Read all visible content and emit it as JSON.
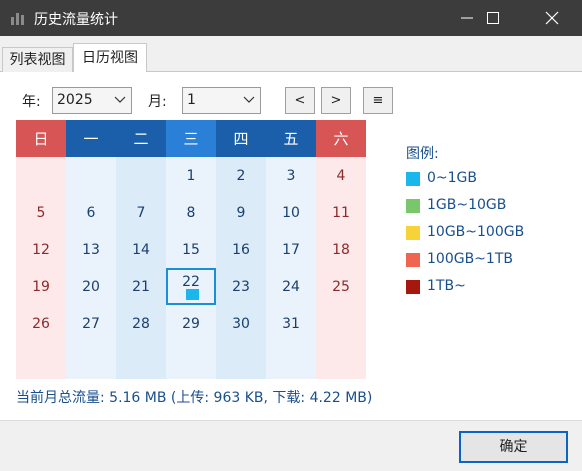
{
  "window": {
    "title": "历史流量统计"
  },
  "tabs": [
    {
      "label": "列表视图"
    },
    {
      "label": "日历视图"
    }
  ],
  "controls": {
    "year_label": "年:",
    "year_value": "2025",
    "month_label": "月:",
    "month_value": "1",
    "prev_label": "<",
    "next_label": ">",
    "menu_label": "≡"
  },
  "calendar": {
    "weekdays": [
      "日",
      "一",
      "二",
      "三",
      "四",
      "五",
      "六"
    ],
    "weeks": [
      [
        "",
        "",
        "",
        "1",
        "2",
        "3",
        "4"
      ],
      [
        "5",
        "6",
        "7",
        "8",
        "9",
        "10",
        "11"
      ],
      [
        "12",
        "13",
        "14",
        "15",
        "16",
        "17",
        "18"
      ],
      [
        "19",
        "20",
        "21",
        "22",
        "23",
        "24",
        "25"
      ],
      [
        "26",
        "27",
        "28",
        "29",
        "30",
        "31",
        ""
      ],
      [
        "",
        "",
        "",
        "",
        "",
        "",
        ""
      ]
    ],
    "selected_day": "22",
    "usage_days": [
      {
        "day": "22",
        "level": "0~1GB"
      }
    ],
    "colors": {
      "weekend_header": "#d85556",
      "weekday_header": "#1b5faa",
      "today_header": "#2a7fd6",
      "weekend_text": "#8c2a2a",
      "weekday_text": "#1a3f6e",
      "weekend_cell": "#fde9ea",
      "weekday_cell_a": "#eaf3fb",
      "weekday_cell_b": "#dcebf8"
    }
  },
  "legend": {
    "title": "图例:",
    "items": [
      {
        "label": "0~1GB",
        "color": "#19b7ec"
      },
      {
        "label": "1GB~10GB",
        "color": "#7ac66a"
      },
      {
        "label": "10GB~100GB",
        "color": "#f7d33a"
      },
      {
        "label": "100GB~1TB",
        "color": "#f0654f"
      },
      {
        "label": "1TB~",
        "color": "#a6170d"
      }
    ]
  },
  "summary": "当前月总流量: 5.16 MB (上传: 963 KB, 下载: 4.22 MB)",
  "footer": {
    "ok_label": "确定"
  }
}
